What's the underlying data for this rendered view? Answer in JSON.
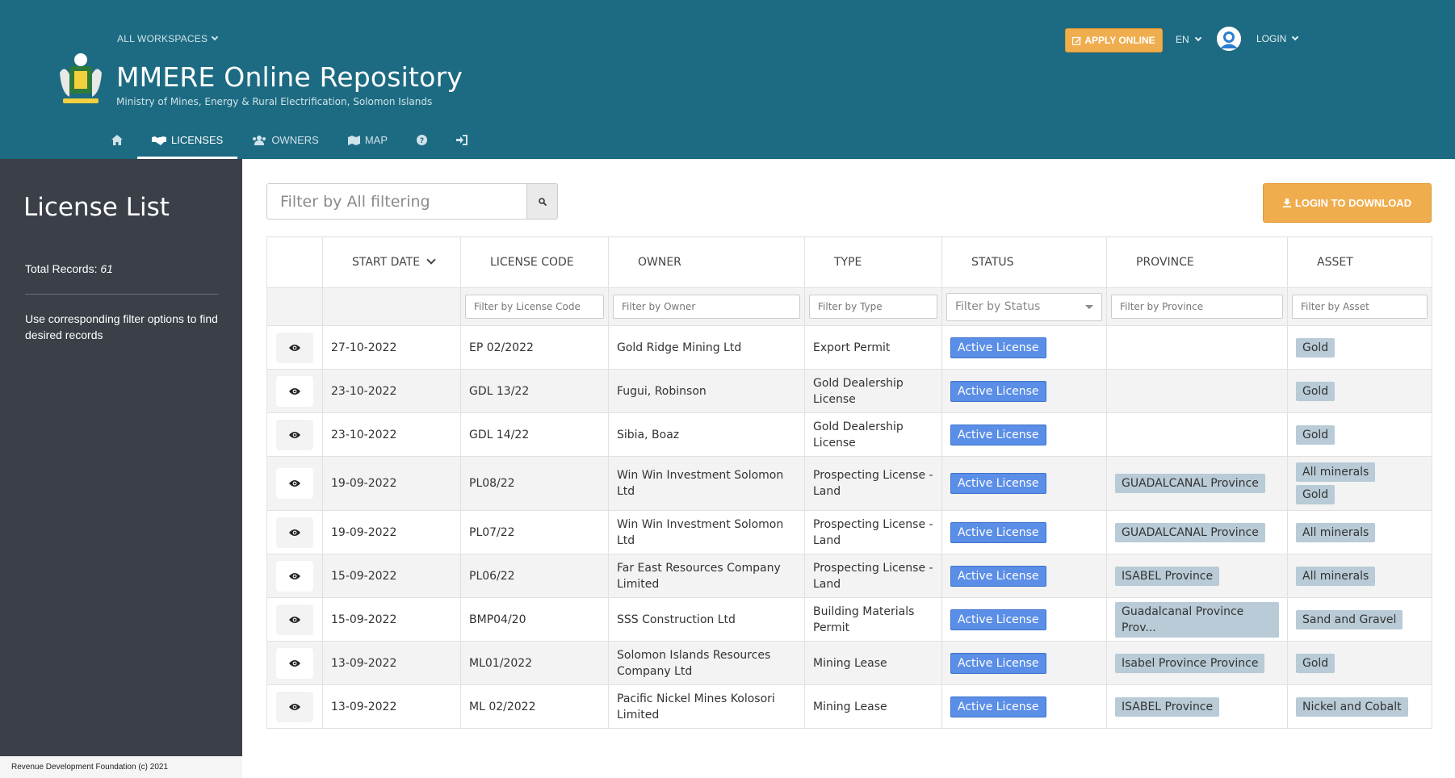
{
  "header": {
    "workspace_label": "ALL WORKSPACES",
    "title": "MMERE Online Repository",
    "subtitle": "Ministry of Mines, Energy & Rural Electrification, Solomon Islands",
    "apply_label": "APPLY ONLINE",
    "lang_label": "EN",
    "login_label": "LOGIN",
    "nav": {
      "licenses": "LICENSES",
      "owners": "OWNERS",
      "map": "MAP"
    },
    "colors": {
      "bar": "#1d6b82",
      "accent": "#f0ad4e"
    }
  },
  "sidebar": {
    "title": "License List",
    "total_label": "Total Records:",
    "total_value": "61",
    "help_text": "Use corresponding filter options to find desired records",
    "footer": "Revenue Development Foundation (c) 2021"
  },
  "toolbar": {
    "search_placeholder": "Filter by All filtering",
    "download_label": "LOGIN TO DOWNLOAD"
  },
  "table": {
    "columns": {
      "start_date": "START DATE",
      "license_code": "LICENSE CODE",
      "owner": "OWNER",
      "type": "TYPE",
      "status": "STATUS",
      "province": "PROVINCE",
      "asset": "ASSET"
    },
    "filters": {
      "license_code": "Filter by License Code",
      "owner": "Filter by Owner",
      "type": "Filter by Type",
      "status": "Filter by Status",
      "province": "Filter by Province",
      "asset": "Filter by Asset"
    },
    "rows": [
      {
        "date": "27-10-2022",
        "code": "EP 02/2022",
        "owner": "Gold Ridge Mining Ltd",
        "type": "Export Permit",
        "status": "Active License",
        "province": "",
        "assets": [
          "Gold"
        ]
      },
      {
        "date": "23-10-2022",
        "code": "GDL 13/22",
        "owner": "Fugui, Robinson",
        "type": "Gold Dealership License",
        "status": "Active License",
        "province": "",
        "assets": [
          "Gold"
        ]
      },
      {
        "date": "23-10-2022",
        "code": "GDL 14/22",
        "owner": "Sibia, Boaz",
        "type": "Gold Dealership License",
        "status": "Active License",
        "province": "",
        "assets": [
          "Gold"
        ]
      },
      {
        "date": "19-09-2022",
        "code": "PL08/22",
        "owner": "Win Win Investment Solomon Ltd",
        "type": "Prospecting License - Land",
        "status": "Active License",
        "province": "GUADALCANAL Province",
        "assets": [
          "All minerals",
          "Gold"
        ]
      },
      {
        "date": "19-09-2022",
        "code": "PL07/22",
        "owner": "Win Win Investment Solomon Ltd",
        "type": "Prospecting License - Land",
        "status": "Active License",
        "province": "GUADALCANAL Province",
        "assets": [
          "All minerals"
        ]
      },
      {
        "date": "15-09-2022",
        "code": "PL06/22",
        "owner": "Far East Resources Company Limited",
        "type": "Prospecting License - Land",
        "status": "Active License",
        "province": "ISABEL Province",
        "assets": [
          "All minerals"
        ]
      },
      {
        "date": "15-09-2022",
        "code": "BMP04/20",
        "owner": "SSS Construction Ltd",
        "type": "Building Materials Permit",
        "status": "Active License",
        "province": "Guadalcanal Province Prov...",
        "assets": [
          "Sand and Gravel"
        ]
      },
      {
        "date": "13-09-2022",
        "code": "ML01/2022",
        "owner": "Solomon Islands Resources Company Ltd",
        "type": "Mining Lease",
        "status": "Active License",
        "province": "Isabel Province Province",
        "assets": [
          "Gold"
        ]
      },
      {
        "date": "13-09-2022",
        "code": "ML 02/2022",
        "owner": "Pacific Nickel Mines Kolosori Limited",
        "type": "Mining Lease",
        "status": "Active License",
        "province": "ISABEL Province",
        "assets": [
          "Nickel and Cobalt"
        ]
      }
    ]
  }
}
